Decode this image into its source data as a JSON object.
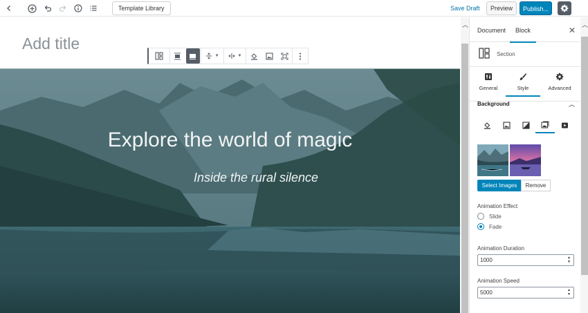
{
  "topbar": {
    "template_library": "Template Library",
    "save_draft": "Save Draft",
    "preview": "Preview",
    "publish": "Publish..."
  },
  "editor": {
    "title_placeholder": "Add title",
    "hero_title": "Explore the world of magic",
    "hero_subtitle": "Inside the rural silence"
  },
  "sidebar": {
    "tab_document": "Document",
    "tab_block": "Block",
    "block_name": "Section",
    "subtabs": {
      "general": "General",
      "style": "Style",
      "advanced": "Advanced"
    },
    "background_heading": "Background",
    "select_images": "Select Images",
    "remove": "Remove",
    "animation_effect_label": "Animation Effect",
    "effect_options": [
      "Slide",
      "Fade"
    ],
    "effect_selected": "Fade",
    "animation_duration_label": "Animation Duration",
    "animation_duration_value": "1000",
    "animation_speed_label": "Animation Speed",
    "animation_speed_value": "5000"
  },
  "colors": {
    "accent": "#0085ba",
    "link": "#0073aa",
    "settings_bg": "#555d66",
    "hero_sky": "#5f8088",
    "hero_forest": "#2c4b4c",
    "hero_water": "#3c6b73"
  }
}
